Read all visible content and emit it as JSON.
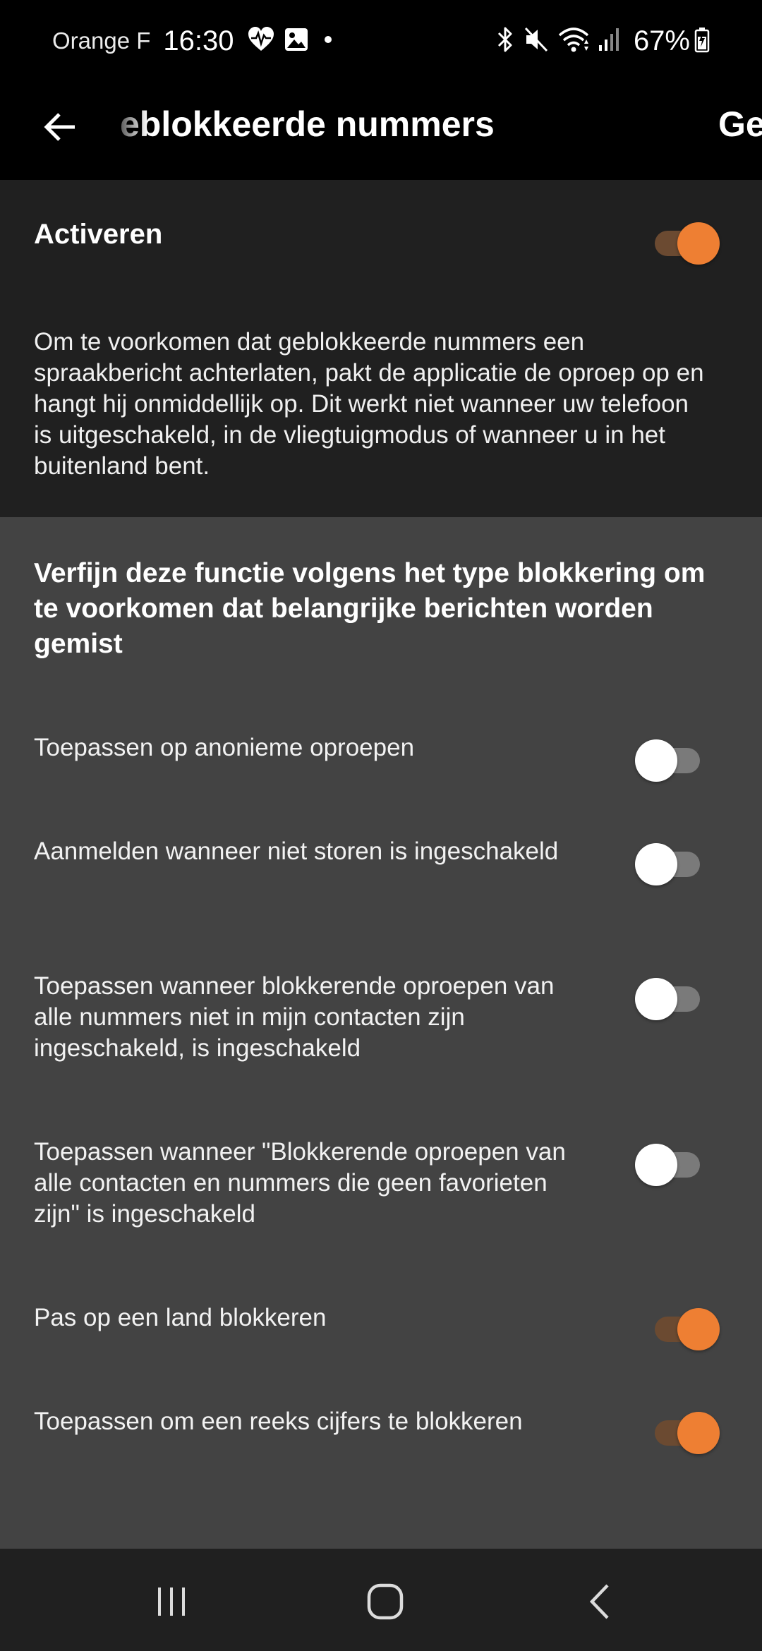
{
  "status_bar": {
    "carrier": "Orange F",
    "time": "16:30",
    "battery": "67%",
    "left_icons": [
      "heart-rate-icon",
      "image-icon",
      "dot-icon"
    ],
    "right_icons": [
      "bluetooth-icon",
      "mute-icon",
      "wifi-icon",
      "signal-icon",
      "battery-icon"
    ]
  },
  "app_bar": {
    "title": "eblokkeerde nummers",
    "title_tail": "Ge",
    "back_icon": "arrow-left-icon"
  },
  "activate": {
    "label": "Activeren",
    "enabled": true,
    "description": "Om te voorkomen dat geblokkeerde nummers een spraakbericht achterlaten, pakt de applicatie de oproep op en hangt hij onmiddellijk op. Dit werkt niet wanneer uw telefoon is uitgeschakeld, in de vliegtuigmodus of wanneer u in het buitenland bent."
  },
  "refine": {
    "heading": "Verfijn deze functie volgens het type blokkering om te voorkomen dat belangrijke berichten worden gemist",
    "options": [
      {
        "label": "Toepassen op anonieme oproepen",
        "enabled": false
      },
      {
        "label": "Aanmelden wanneer niet storen is ingeschakeld",
        "enabled": false
      },
      {
        "label": "Toepassen wanneer blokkerende oproepen van alle nummers niet in mijn contacten zijn ingeschakeld, is ingeschakeld",
        "enabled": false
      },
      {
        "label": "Toepassen wanneer \"Blokkerende oproepen van alle contacten en nummers die geen favorieten zijn\" is ingeschakeld",
        "enabled": false
      },
      {
        "label": "Pas op een land blokkeren",
        "enabled": true
      },
      {
        "label": "Toepassen om een reeks cijfers te blokkeren",
        "enabled": true
      }
    ]
  },
  "nav_bar": {
    "buttons": [
      "recent-apps-icon",
      "home-icon",
      "back-icon"
    ]
  },
  "colors": {
    "accent": "#ee7f33",
    "accent_track": "#6b4a31",
    "top_section_bg": "#202020",
    "bottom_section_bg": "#434343"
  }
}
